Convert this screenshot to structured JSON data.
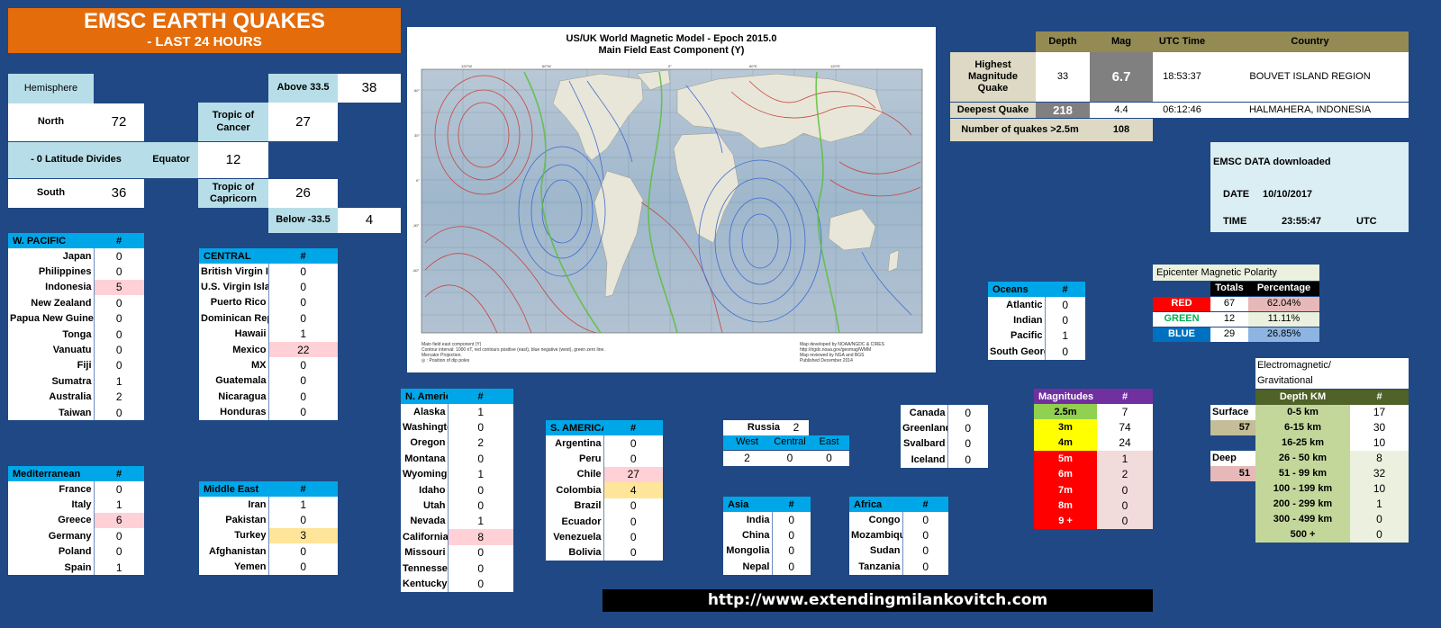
{
  "title": {
    "line1": "EMSC EARTH QUAKES",
    "line2": "- LAST 24 HOURS"
  },
  "hemisphere": {
    "header": "Hemisphere",
    "north_label": "North",
    "north_value": "72",
    "divides_label": "- 0 Latitude Divides",
    "south_label": "South",
    "south_value": "36"
  },
  "latitude_bands": {
    "above_label": "Above 33.5",
    "above_value": "38",
    "cancer_label": "Tropic of Cancer",
    "cancer_value": "27",
    "equator_label": "Equator",
    "equator_value": "12",
    "capricorn_label": "Tropic of Capricorn",
    "capricorn_value": "26",
    "below_label": "Below -33.5",
    "below_value": "4"
  },
  "map": {
    "title_line1": "US/UK World Magnetic Model - Epoch 2015.0",
    "title_line2": "Main Field East Component (Y)",
    "notes_left": "Main field east component (Y)\nContour interval: 1000 nT, red contours positive (east), blue negative (west), green zero line.\nMercator Projection.\n◎ : Position of dip poles",
    "notes_right": "Map developed by NOAA/NGDC & CIRES\nhttp://ngdc.noaa.gov/geomag/WMM\nMap reviewed by NGA and BGS\nPublished December 2014"
  },
  "summary": {
    "headers": [
      "Depth",
      "Mag",
      "UTC Time",
      "Country"
    ],
    "highest_label": "Highest Magnitude Quake",
    "highest": {
      "depth": "33",
      "mag": "6.7",
      "time": "18:53:37",
      "country": "BOUVET ISLAND REGION"
    },
    "deepest_label": "Deepest Quake",
    "deepest": {
      "depth": "218",
      "mag": "4.4",
      "time": "06:12:46",
      "country": "HALMAHERA, INDONESIA"
    },
    "count_label": "Number of quakes >2.5m",
    "count_value": "108"
  },
  "download": {
    "label": "EMSC DATA downloaded",
    "date_label": "DATE",
    "date_value": "10/10/2017",
    "time_label": "TIME",
    "time_value": "23:55:47",
    "tz": "UTC"
  },
  "hash": "#",
  "w_pacific": {
    "title": "W. PACIFIC",
    "rows": [
      {
        "name": "Japan",
        "value": "0"
      },
      {
        "name": "Philippines",
        "value": "0"
      },
      {
        "name": "Indonesia",
        "value": "5"
      },
      {
        "name": "New Zealand",
        "value": "0"
      },
      {
        "name": "Papua New Guinea",
        "value": "0"
      },
      {
        "name": "Tonga",
        "value": "0"
      },
      {
        "name": "Vanuatu",
        "value": "0"
      },
      {
        "name": "Fiji",
        "value": "0"
      },
      {
        "name": "Sumatra",
        "value": "1"
      },
      {
        "name": "Australia",
        "value": "2"
      },
      {
        "name": "Taiwan",
        "value": "0"
      }
    ]
  },
  "central": {
    "title": "CENTRAL",
    "rows": [
      {
        "name": "British Virgin Islands",
        "value": "0"
      },
      {
        "name": "U.S. Virgin Islands",
        "value": "0"
      },
      {
        "name": "Puerto Rico",
        "value": "0"
      },
      {
        "name": "Dominican Republic",
        "value": "0"
      },
      {
        "name": "Hawaii",
        "value": "1"
      },
      {
        "name": "Mexico",
        "value": "22"
      },
      {
        "name": "MX",
        "value": "0"
      },
      {
        "name": "Guatemala",
        "value": "0"
      },
      {
        "name": "Nicaragua",
        "value": "0"
      },
      {
        "name": "Honduras",
        "value": "0"
      }
    ]
  },
  "mediterranean": {
    "title": "Mediterranean",
    "rows": [
      {
        "name": "France",
        "value": "0"
      },
      {
        "name": "Italy",
        "value": "1"
      },
      {
        "name": "Greece",
        "value": "6"
      },
      {
        "name": "Germany",
        "value": "0"
      },
      {
        "name": "Poland",
        "value": "0"
      },
      {
        "name": "Spain",
        "value": "1"
      }
    ]
  },
  "middle_east": {
    "title": "Middle East",
    "rows": [
      {
        "name": "Iran",
        "value": "1"
      },
      {
        "name": "Pakistan",
        "value": "0"
      },
      {
        "name": "Turkey",
        "value": "3"
      },
      {
        "name": "Afghanistan",
        "value": "0"
      },
      {
        "name": "Yemen",
        "value": "0"
      }
    ]
  },
  "n_america": {
    "title": "N. America",
    "rows": [
      {
        "name": "Alaska",
        "value": "1"
      },
      {
        "name": "Washington",
        "value": "0"
      },
      {
        "name": "Oregon",
        "value": "2"
      },
      {
        "name": "Montana",
        "value": "0"
      },
      {
        "name": "Wyoming",
        "value": "1"
      },
      {
        "name": "Idaho",
        "value": "0"
      },
      {
        "name": "Utah",
        "value": "0"
      },
      {
        "name": "Nevada",
        "value": "1"
      },
      {
        "name": "California",
        "value": "8"
      },
      {
        "name": "Missouri",
        "value": "0"
      },
      {
        "name": "Tennessee",
        "value": "0"
      },
      {
        "name": "Kentucky",
        "value": "0"
      }
    ]
  },
  "s_america": {
    "title": "S. AMERICA",
    "rows": [
      {
        "name": "Argentina",
        "value": "0"
      },
      {
        "name": "Peru",
        "value": "0"
      },
      {
        "name": "Chile",
        "value": "27"
      },
      {
        "name": "Colombia",
        "value": "4"
      },
      {
        "name": "Brazil",
        "value": "0"
      },
      {
        "name": "Ecuador",
        "value": "0"
      },
      {
        "name": "Venezuela",
        "value": "0"
      },
      {
        "name": "Bolivia",
        "value": "0"
      }
    ]
  },
  "russia": {
    "label": "Russia",
    "value": "2",
    "west_label": "West",
    "central_label": "Central",
    "east_label": "East",
    "west_value": "2",
    "central_value": "0",
    "east_value": "0"
  },
  "asia": {
    "title": "Asia",
    "rows": [
      {
        "name": "India",
        "value": "0"
      },
      {
        "name": "China",
        "value": "0"
      },
      {
        "name": "Mongolia",
        "value": "0"
      },
      {
        "name": "Nepal",
        "value": "0"
      }
    ]
  },
  "africa": {
    "title": "Africa",
    "rows": [
      {
        "name": "Congo",
        "value": "0"
      },
      {
        "name": "Mozambique",
        "value": "0"
      },
      {
        "name": "Sudan",
        "value": "0"
      },
      {
        "name": "Tanzania",
        "value": "0"
      }
    ]
  },
  "north_atlantic": {
    "rows": [
      {
        "name": "Canada",
        "value": "0"
      },
      {
        "name": "Greenland",
        "value": "0"
      },
      {
        "name": "Svalbard",
        "value": "0"
      },
      {
        "name": "Iceland",
        "value": "0"
      }
    ]
  },
  "oceans": {
    "title": "Oceans",
    "rows": [
      {
        "name": "Atlantic",
        "value": "0"
      },
      {
        "name": "Indian",
        "value": "0"
      },
      {
        "name": "Pacific",
        "value": "1"
      },
      {
        "name": "South Georgia",
        "value": "0"
      }
    ]
  },
  "polarity": {
    "title": "Epicenter Magnetic Polarity",
    "col_totals": "Totals",
    "col_pct": "Percentage",
    "rows": [
      {
        "label": "RED",
        "total": "67",
        "pct": "62.04%",
        "color": "#ff0000",
        "pct_fraction": 0.6204
      },
      {
        "label": "GREEN",
        "total": "12",
        "pct": "11.11%",
        "color": "#00b050",
        "pct_fraction": 0.1111
      },
      {
        "label": "BLUE",
        "total": "29",
        "pct": "26.85%",
        "color": "#0070c0",
        "pct_fraction": 0.2685
      }
    ]
  },
  "magnitudes": {
    "title": "Magnitudes",
    "rows": [
      {
        "name": "2.5m",
        "value": "7"
      },
      {
        "name": "3m",
        "value": "74"
      },
      {
        "name": "4m",
        "value": "24"
      },
      {
        "name": "5m",
        "value": "1"
      },
      {
        "name": "6m",
        "value": "2"
      },
      {
        "name": "7m",
        "value": "0"
      },
      {
        "name": "8m",
        "value": "0"
      },
      {
        "name": "9 +",
        "value": "0"
      }
    ]
  },
  "depth": {
    "title_line1": "Electromagnetic/",
    "title_line2": "Gravitational",
    "col_depth": "Depth KM",
    "surface_label": "Surface",
    "surface_total": "57",
    "deep_label": "Deep",
    "deep_total": "51",
    "rows": [
      {
        "name": "0-5 km",
        "value": "17"
      },
      {
        "name": "6-15 km",
        "value": "30"
      },
      {
        "name": "16-25 km",
        "value": "10"
      },
      {
        "name": "26 - 50 km",
        "value": "8"
      },
      {
        "name": "51 - 99 km",
        "value": "32"
      },
      {
        "name": "100 - 199 km",
        "value": "10"
      },
      {
        "name": "200 - 299 km",
        "value": "1"
      },
      {
        "name": "300 - 499 km",
        "value": "0"
      },
      {
        "name": "500 +",
        "value": "0"
      }
    ]
  },
  "url": "http://www.extendingmilankovitch.com",
  "colors": {
    "background": "#1f4884",
    "title": "#e46c0a",
    "header_blue": "#00a7e8",
    "header_purple": "#7030a0",
    "olive": "#948a54",
    "depth_green": "#c4d79b"
  }
}
